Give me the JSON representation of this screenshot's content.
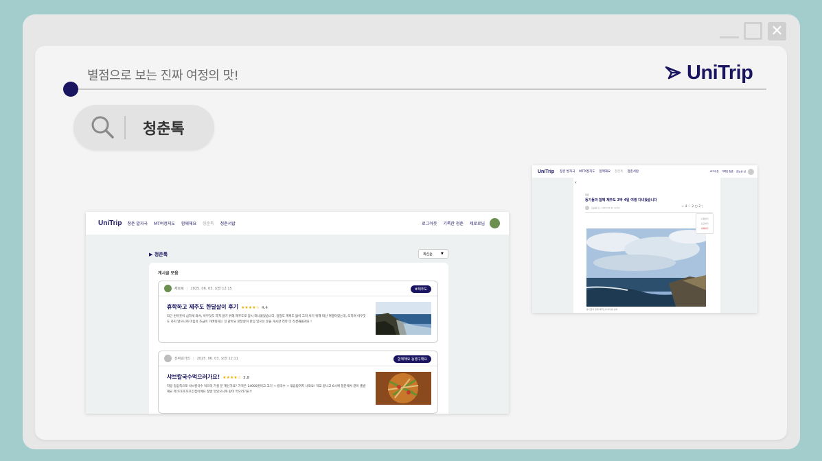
{
  "tagline": "별점으로 보는 진짜 여정의 맛!",
  "brand": {
    "name": "UniTrip",
    "color": "#1a1560"
  },
  "search": {
    "text": "청춘톡",
    "icon": "search-icon"
  },
  "window_controls": {
    "minimize": "minimize-icon",
    "maximize": "maximize-icon",
    "close": "close-icon",
    "close_glyph": "✕"
  },
  "screen1": {
    "nav": {
      "logo": "UniTrip",
      "items": [
        "청춘 발자국",
        "MT여정지도",
        "함께해요",
        "청춘톡",
        "청춘서랍"
      ],
      "right": [
        "로그아웃",
        "기록한 청춘",
        "제로로님"
      ]
    },
    "section_title": "▶ 청춘톡",
    "sort": {
      "value": "최신순",
      "arrow": "▼"
    },
    "list_title": "게시글 모음",
    "posts": [
      {
        "author": "제로로",
        "date": "2025. 06. 03. 오전 12:15",
        "tag": "#제주도",
        "title": "휴학하고 제주도 한달살이 후기",
        "stars": "★★★★☆",
        "rating": "4.4",
        "body": "최근 번아웃이 심하게 와서, 아무것도 하지 않기 위해 제주도로 잠시 떠나왔었습니다. 일정도 계획도 없이 그저 쉬기 위해 떠난 여행이었는데, 오히려 아무것도 하지 않으니까 마음의 조급이 가벼워지는 것 같아요 한달살이 한심 있으신 분을 게시한 리뷰 더 작성해볼게요 !"
      },
      {
        "author": "진짜김가인",
        "date": "2025. 06. 03. 오전 12:11",
        "tag": "함께해요 동행구해요",
        "title": "샤브칼국수먹으러가요!",
        "stars": "★★★★☆",
        "rating": "3.8",
        "body": "저랑 점심쪽으로 샤브칼국수 먹으러 가실 분 계신가요? 가격은 14000원이고 고기 + 칼국수 + 볶음밥까지 나와요! 학교 끝나고 6시에 정문에서 같이 출발해요 제 또또또또또간집이에요 정말 맛있으니까 같이 먹으러가요!!"
      }
    ]
  },
  "screen2": {
    "nav": {
      "logo": "UniTrip",
      "items": [
        "청춘 발자국",
        "MT여정지도",
        "함께해요",
        "청춘톡",
        "청춘서랍"
      ],
      "right": [
        "로그아웃",
        "기록한 청춘",
        "김눈송 님"
      ]
    },
    "back": "‹",
    "category": "청춘",
    "post_title": "동기들과 함께 제주도 3박 4일 여행 다녀왔습니다",
    "meta": "김눈송 님 · 2025.05.30 12:01",
    "counts": "☆ 4 ♡ 2 ▢ 2 ⋮",
    "menu": [
      "수정하기",
      "신고하기",
      "삭제하기"
    ],
    "caption": "동기들과 함께 제주도의 바다를 보며"
  }
}
